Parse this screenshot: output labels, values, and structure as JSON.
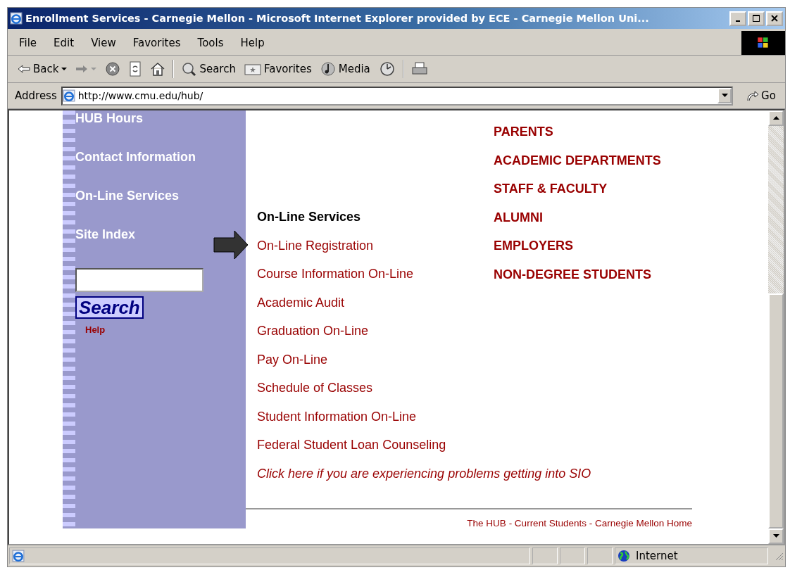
{
  "window": {
    "title": "Enrollment Services - Carnegie Mellon - Microsoft Internet Explorer provided by ECE - Carnegie Mellon Uni..."
  },
  "menu": [
    "File",
    "Edit",
    "View",
    "Favorites",
    "Tools",
    "Help"
  ],
  "toolbar": [
    {
      "kind": "back",
      "label": "Back"
    },
    {
      "kind": "forward"
    },
    {
      "kind": "stop"
    },
    {
      "kind": "refresh"
    },
    {
      "kind": "home"
    },
    {
      "kind": "sep"
    },
    {
      "kind": "search",
      "label": "Search"
    },
    {
      "kind": "favorites",
      "label": "Favorites"
    },
    {
      "kind": "media",
      "label": "Media"
    },
    {
      "kind": "history"
    },
    {
      "kind": "sep"
    },
    {
      "kind": "print"
    }
  ],
  "address": {
    "label": "Address",
    "value": "http://www.cmu.edu/hub/",
    "go": "Go"
  },
  "sidebar": {
    "items": [
      "HUB Hours",
      "Contact Information",
      "On-Line Services",
      "Site Index"
    ],
    "search_button": "Search",
    "help": "Help"
  },
  "services": {
    "heading": "On-Line Services",
    "links": [
      {
        "text": "On-Line Registration",
        "italic": false
      },
      {
        "text": "Course Information On-Line",
        "italic": false
      },
      {
        "text": "Academic Audit",
        "italic": false
      },
      {
        "text": "Graduation On-Line",
        "italic": false
      },
      {
        "text": "Pay On-Line",
        "italic": false
      },
      {
        "text": "Schedule of Classes",
        "italic": false
      },
      {
        "text": "Student Information On-Line",
        "italic": false
      },
      {
        "text": "Federal Student Loan Counseling",
        "italic": false
      },
      {
        "text": "Click here if you are experiencing problems getting into SIO",
        "italic": true
      }
    ]
  },
  "audiences": [
    "PARENTS",
    "ACADEMIC DEPARTMENTS",
    "STAFF & FACULTY",
    "ALUMNI",
    "EMPLOYERS",
    "NON-DEGREE STUDENTS"
  ],
  "footer": "The HUB - Current Students - Carnegie Mellon Home",
  "status_bar": {
    "zone": "Internet"
  }
}
